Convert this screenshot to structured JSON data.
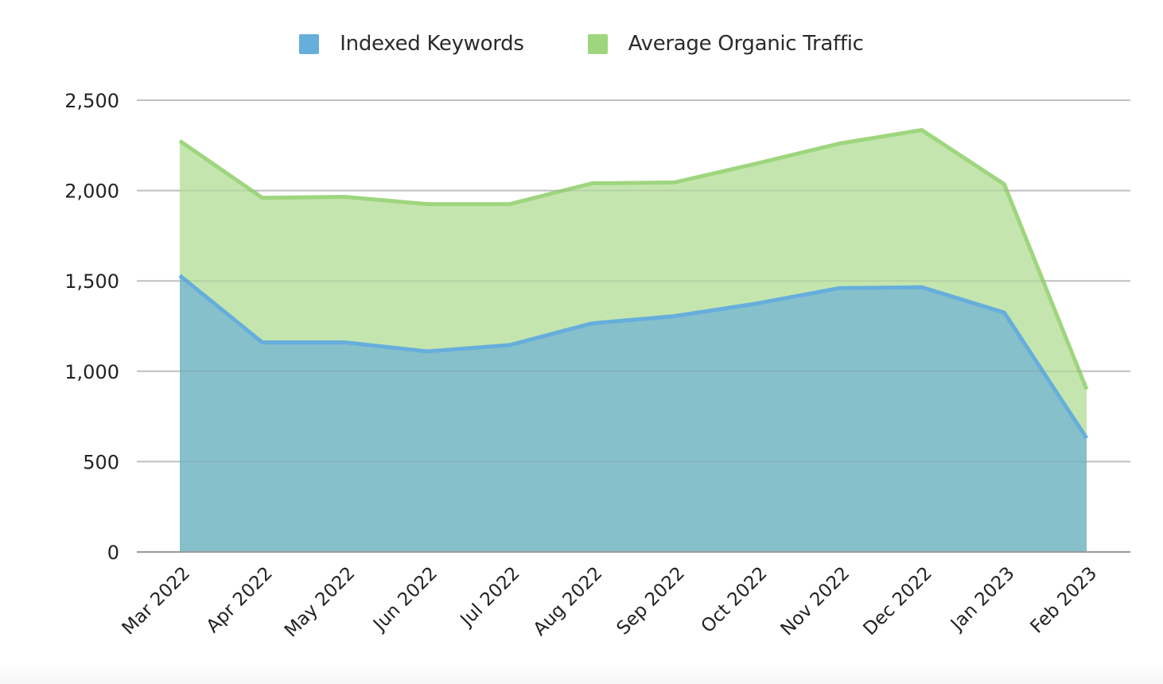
{
  "chart_data": {
    "type": "area",
    "stacked": true,
    "title": "",
    "xlabel": "",
    "ylabel": "",
    "categories": [
      "Mar 2022",
      "Apr 2022",
      "May 2022",
      "Jun 2022",
      "Jul 2022",
      "Aug 2022",
      "Sep 2022",
      "Oct 2022",
      "Nov 2022",
      "Dec 2022",
      "Jan 2023",
      "Feb 2023"
    ],
    "series": [
      {
        "name": "Indexed Keywords",
        "color": "#66aedc",
        "fill": "#86c0cb",
        "values": [
          1530,
          1160,
          1160,
          1110,
          1145,
          1265,
          1305,
          1375,
          1460,
          1465,
          1325,
          630
        ]
      },
      {
        "name": "Average Organic Traffic",
        "color": "#9ed67e",
        "fill": "#c4e6ae",
        "values": [
          745,
          800,
          805,
          815,
          780,
          775,
          740,
          775,
          800,
          870,
          710,
          270
        ]
      }
    ],
    "ylim": [
      0,
      2500
    ],
    "yticks": [
      0,
      500,
      1000,
      1500,
      2000,
      2500
    ],
    "ytick_labels": [
      "0",
      "500",
      "1,000",
      "1,500",
      "2,000",
      "2,500"
    ],
    "grid": true,
    "legend_position": "top-center"
  },
  "legend": {
    "items": [
      {
        "label": "Indexed Keywords",
        "color": "#66aedc"
      },
      {
        "label": "Average Organic Traffic",
        "color": "#9ed67e"
      }
    ]
  }
}
